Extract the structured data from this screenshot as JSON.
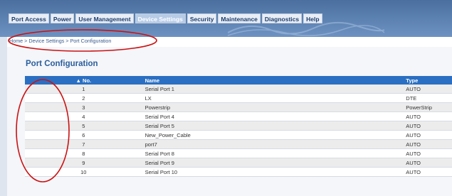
{
  "nav": {
    "items": [
      "Port Access",
      "Power",
      "User Management",
      "Device Settings",
      "Security",
      "Maintenance",
      "Diagnostics",
      "Help"
    ],
    "active": "Device Settings"
  },
  "breadcrumb": "Home > Device Settings > Port Configuration",
  "page_title": "Port Configuration",
  "table": {
    "headers": [
      "▲ No.",
      "Name",
      "Type"
    ],
    "rows": [
      {
        "no": "1",
        "name": "Serial Port 1",
        "type": "AUTO",
        "link": true
      },
      {
        "no": "2",
        "name": "LX",
        "type": "DTE",
        "link": true
      },
      {
        "no": "3",
        "name": "Powerstrip",
        "type": "PowerStrip",
        "link": true
      },
      {
        "no": "4",
        "name": "Serial Port 4",
        "type": "AUTO",
        "link": true
      },
      {
        "no": "5",
        "name": "Serial Port 5",
        "type": "AUTO",
        "link": true
      },
      {
        "no": "6",
        "name": "New_Power_Cable",
        "type": "AUTO",
        "link": true
      },
      {
        "no": "7",
        "name": "port7",
        "type": "AUTO",
        "link": true
      },
      {
        "no": "8",
        "name": "Serial Port 8",
        "type": "AUTO",
        "link": true
      },
      {
        "no": "9",
        "name": "Serial Port 9",
        "type": "AUTO",
        "link": true
      },
      {
        "no": "10",
        "name": "Serial Port 10",
        "type": "AUTO",
        "link": true
      }
    ]
  },
  "colors": {
    "header_blue": "#2a6fc2",
    "title_blue": "#2b5e9c",
    "annotation_red": "#cc1111"
  }
}
